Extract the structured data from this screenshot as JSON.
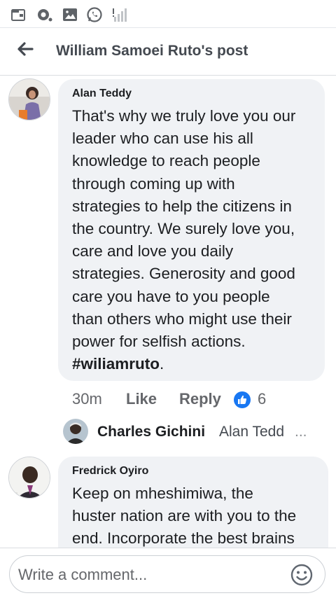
{
  "status_bar": {
    "icons": [
      "wallet-icon",
      "camera-notification-icon",
      "image-icon",
      "whatsapp-icon",
      "no-signal-icon"
    ]
  },
  "header": {
    "back_icon": "arrow-left-icon",
    "title": "William Samoei Ruto's post"
  },
  "comments": [
    {
      "author": "Alan Teddy",
      "lines": [
        "That's why we truly love you our",
        "leader who can use his all",
        "knowledge to reach people",
        "through coming up with",
        "strategies to help the citizens in",
        "the country. We surely love you,",
        "care and love you daily",
        "strategies. Generosity and good",
        "care you have to you people",
        "than others who might use their",
        "power for selfish actions."
      ],
      "hashtag": "#wiliamruto",
      "hashtag_suffix": ".",
      "time": "30m",
      "like_label": "Like",
      "reply_label": "Reply",
      "reaction_count": "6",
      "reaction_icon": "thumbs-up-icon",
      "reply_preview": {
        "name": "Charles Gichini",
        "snippet": "Alan Tedd",
        "ellipsis": "..."
      }
    },
    {
      "author": "Fredrick Oyiro",
      "lines": [
        "Keep on mheshimiwa, the",
        "huster nation are with you to the",
        "end. Incorporate the best brains"
      ]
    }
  ],
  "composer": {
    "placeholder": "Write a comment...",
    "emoji_icon": "smiley-icon"
  },
  "colors": {
    "like_blue": "#1877f2",
    "bubble": "#f0f2f5",
    "meta_gray": "#65676b"
  }
}
